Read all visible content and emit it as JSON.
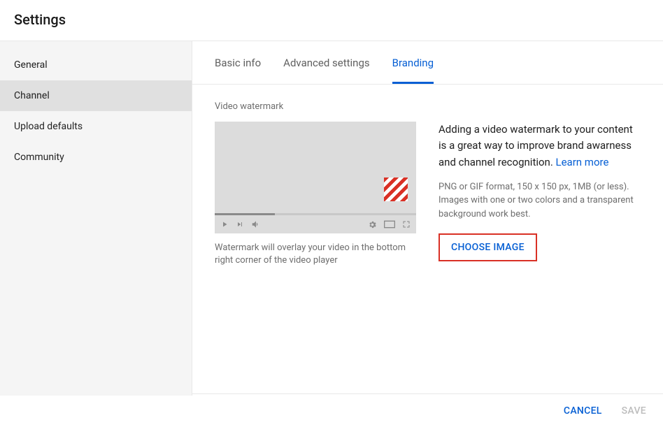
{
  "header": {
    "title": "Settings"
  },
  "sidebar": {
    "items": [
      {
        "label": "General",
        "active": false
      },
      {
        "label": "Channel",
        "active": true
      },
      {
        "label": "Upload defaults",
        "active": false
      },
      {
        "label": "Community",
        "active": false
      }
    ]
  },
  "tabs": [
    {
      "label": "Basic info",
      "active": false
    },
    {
      "label": "Advanced settings",
      "active": false
    },
    {
      "label": "Branding",
      "active": true
    }
  ],
  "section": {
    "label": "Video watermark",
    "caption": "Watermark will overlay your video in the bottom right corner of the video player",
    "desc_main_pre": "Adding a video watermark to your content is a great way to improve brand awarness and channel recognition. ",
    "learn_more": "Learn more",
    "desc_sub": "PNG or GIF format, 150 x 150 px, 1MB (or less). Images with one or two colors and a transparent background work best.",
    "choose_btn": "CHOOSE IMAGE"
  },
  "footer": {
    "cancel": "CANCEL",
    "save": "SAVE"
  }
}
